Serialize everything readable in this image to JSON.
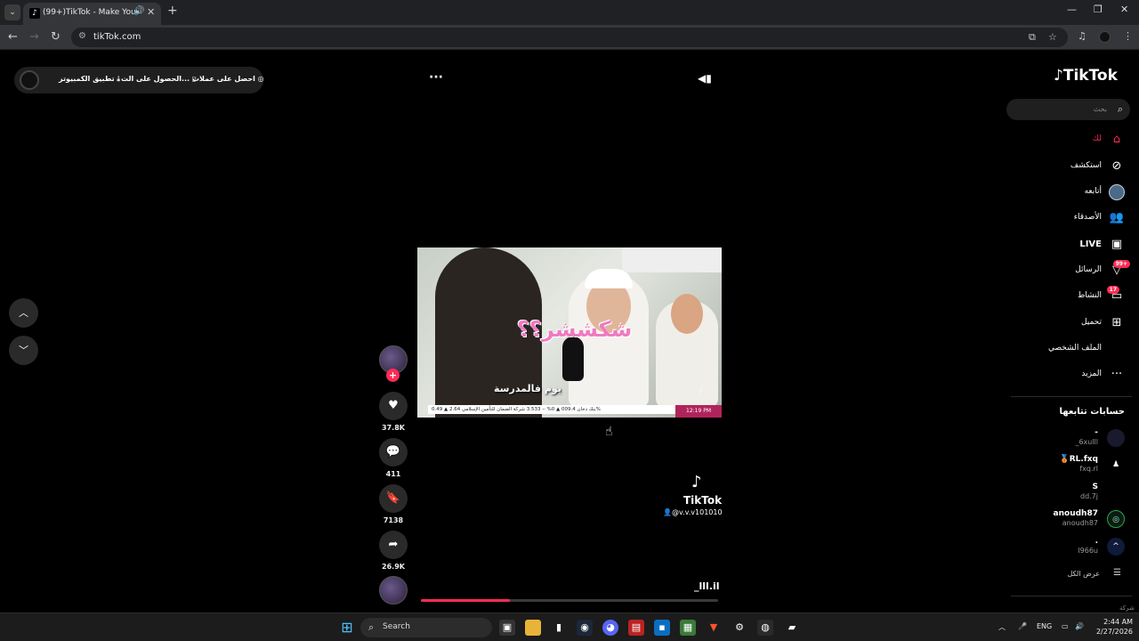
{
  "browser": {
    "tab_title": "(99+)TikTok - Make Your Day",
    "url": "tikTok.com"
  },
  "header": {
    "coins_label": "احصل على عملات",
    "get_app_label": "الحصول على الت...",
    "pc_app_label": "تطبيق الكمبيوتر"
  },
  "sidebar": {
    "logo": "TikTok",
    "search_placeholder": "بحث",
    "items": [
      {
        "label": "لك",
        "icon": "home-icon",
        "active": true
      },
      {
        "label": "استكشف",
        "icon": "compass-icon"
      },
      {
        "label": "أتابعه",
        "icon": "following-avatar-icon"
      },
      {
        "label": "الأصدقاء",
        "icon": "friends-icon"
      },
      {
        "label": "LIVE",
        "icon": "live-icon"
      },
      {
        "label": "الرسائل",
        "icon": "messages-icon",
        "badge": "99+"
      },
      {
        "label": "النشاط",
        "icon": "activity-icon",
        "badge": "17"
      },
      {
        "label": "تحميل",
        "icon": "upload-icon"
      },
      {
        "label": "الملف الشخصي",
        "icon": "profile-icon"
      },
      {
        "label": "المزيد",
        "icon": "more-icon"
      }
    ],
    "following_title": "حسابات تتابعها",
    "following": [
      {
        "name": "-",
        "handle": "_6xulll"
      },
      {
        "name": "RL.fxq",
        "handle": "fxq.rl"
      },
      {
        "name": "S",
        "handle": "dd.7j"
      },
      {
        "name": "anoudh87",
        "handle": "anoudh87"
      },
      {
        "name": ".",
        "handle": "l966u"
      }
    ],
    "see_all": "عرض الكل",
    "cut_text": "شركة"
  },
  "video": {
    "caption_big": "شكششر؟؟",
    "caption_small": "يوم فالمدرسة",
    "ticker": "بنك دخان 009.4 ▲ 0% ‒ 3.533 شركة الضمان للتأمين الإسلامي 2.64 ▲ 0.49%",
    "ticker_time": "12:19 PM",
    "watermark_brand": "TikTok",
    "watermark_user": "@v.v.v101010",
    "author": "_lll.il",
    "progress": 0.3
  },
  "actions": {
    "likes": "37.8K",
    "comments": "411",
    "saves": "7138",
    "shares": "26.9K"
  },
  "taskbar": {
    "search_label": "Search",
    "lang": "ENG",
    "time": "2:44 AM",
    "date": "2/27/2026"
  }
}
